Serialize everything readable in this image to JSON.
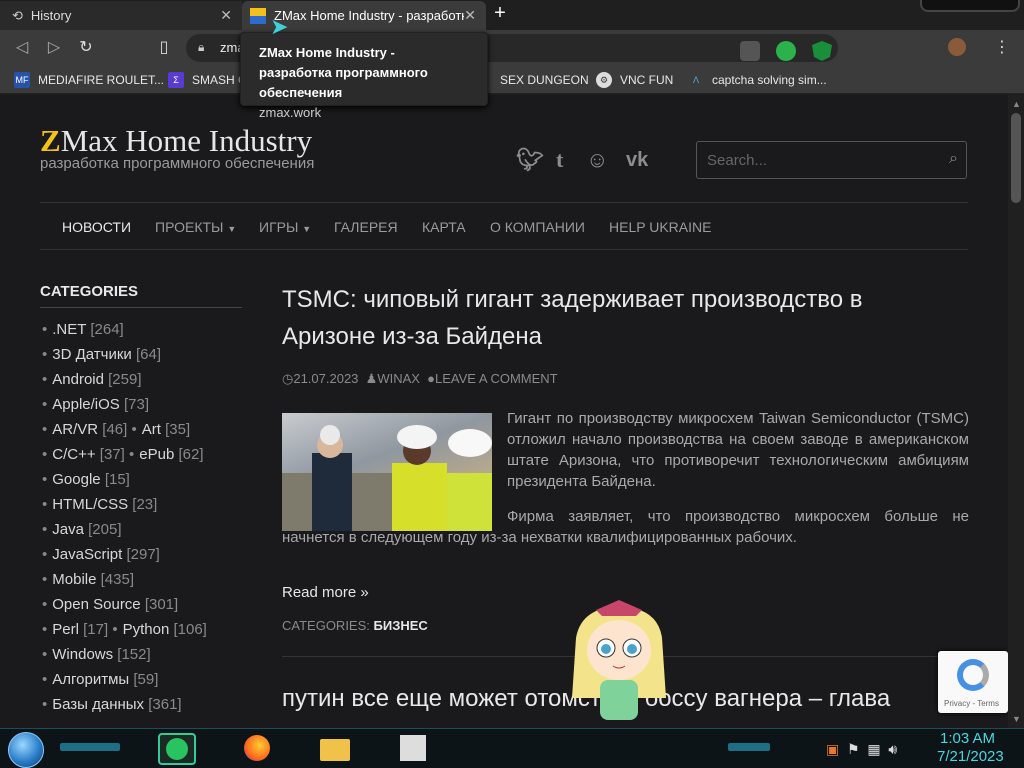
{
  "tabs": [
    {
      "label": "History"
    },
    {
      "label": "ZMax Home Industry - разработка программного обеспечения"
    }
  ],
  "url": "zmax.work",
  "tooltip": {
    "title": "ZMax Home Industry - разработка программного обеспечения",
    "domain": "zmax.work"
  },
  "bookmarks": [
    {
      "label": "MEDIAFIRE ROULET..."
    },
    {
      "label": "SMASH G"
    },
    {
      "label": "SEX DUNGEON"
    },
    {
      "label": "VNC FUN"
    },
    {
      "label": "captcha solving sim..."
    }
  ],
  "site": {
    "logo_z": "Z",
    "logo_rest": "Max Home Industry",
    "tagline": "разработка программного обеспечения",
    "search_placeholder": "Search...",
    "menu": [
      "НОВОСТИ",
      "ПРОЕКТЫ",
      "ИГРЫ",
      "ГАЛЕРЕЯ",
      "КАРТА",
      "О КОМПАНИИ",
      "HELP UKRAINE"
    ],
    "categories_title": "CATEGORIES",
    "categories": [
      {
        "name": ".NET",
        "count": "[264]"
      },
      {
        "name": "3D Датчики",
        "count": "[64]"
      },
      {
        "name": "Android",
        "count": "[259]"
      },
      {
        "name": "Apple/iOS",
        "count": "[73]"
      },
      {
        "name": "AR/VR",
        "count": "[46]"
      },
      {
        "name": "Art",
        "count": "[35]"
      },
      {
        "name": "C/C++",
        "count": "[37]"
      },
      {
        "name": "ePub",
        "count": "[62]"
      },
      {
        "name": "Google",
        "count": "[15]"
      },
      {
        "name": "HTML/CSS",
        "count": "[23]"
      },
      {
        "name": "Java",
        "count": "[205]"
      },
      {
        "name": "JavaScript",
        "count": "[297]"
      },
      {
        "name": "Mobile",
        "count": "[435]"
      },
      {
        "name": "Open Source",
        "count": "[301]"
      },
      {
        "name": "Perl",
        "count": "[17]"
      },
      {
        "name": "Python",
        "count": "[106]"
      },
      {
        "name": "Windows",
        "count": "[152]"
      },
      {
        "name": "Алгоритмы",
        "count": "[59]"
      },
      {
        "name": "Базы данных",
        "count": "[361]"
      }
    ],
    "post": {
      "title": "TSMC: чиповый гигант задерживает производство в Аризоне из-за Байдена",
      "date": "21.07.2023",
      "author": "WINAX",
      "comment": "LEAVE A COMMENT",
      "p1": "Гигант по производству микросхем Taiwan Semiconductor (TSMC) отложил начало производства на своем заводе в американском штате Аризона, что противоречит технологическим амбициям президента Байдена.",
      "p2": "Фирма заявляет, что производство микросхем больше не начнется в следующем году из-за нехватки квалифицированных рабочих.",
      "readmore": "Read more »",
      "cats_label": "CATEGORIES:",
      "cats_value": "БИЗНЕС"
    },
    "post2_title": "путин все еще может отомстить боссу вагнера – глава",
    "recaptcha": "Privacy - Terms"
  },
  "taskbar": {
    "time": "1:03 AM",
    "date": "7/21/2023"
  },
  "colors": {
    "accent": "#4bd5e0",
    "logo_z": "#f2c21b"
  }
}
